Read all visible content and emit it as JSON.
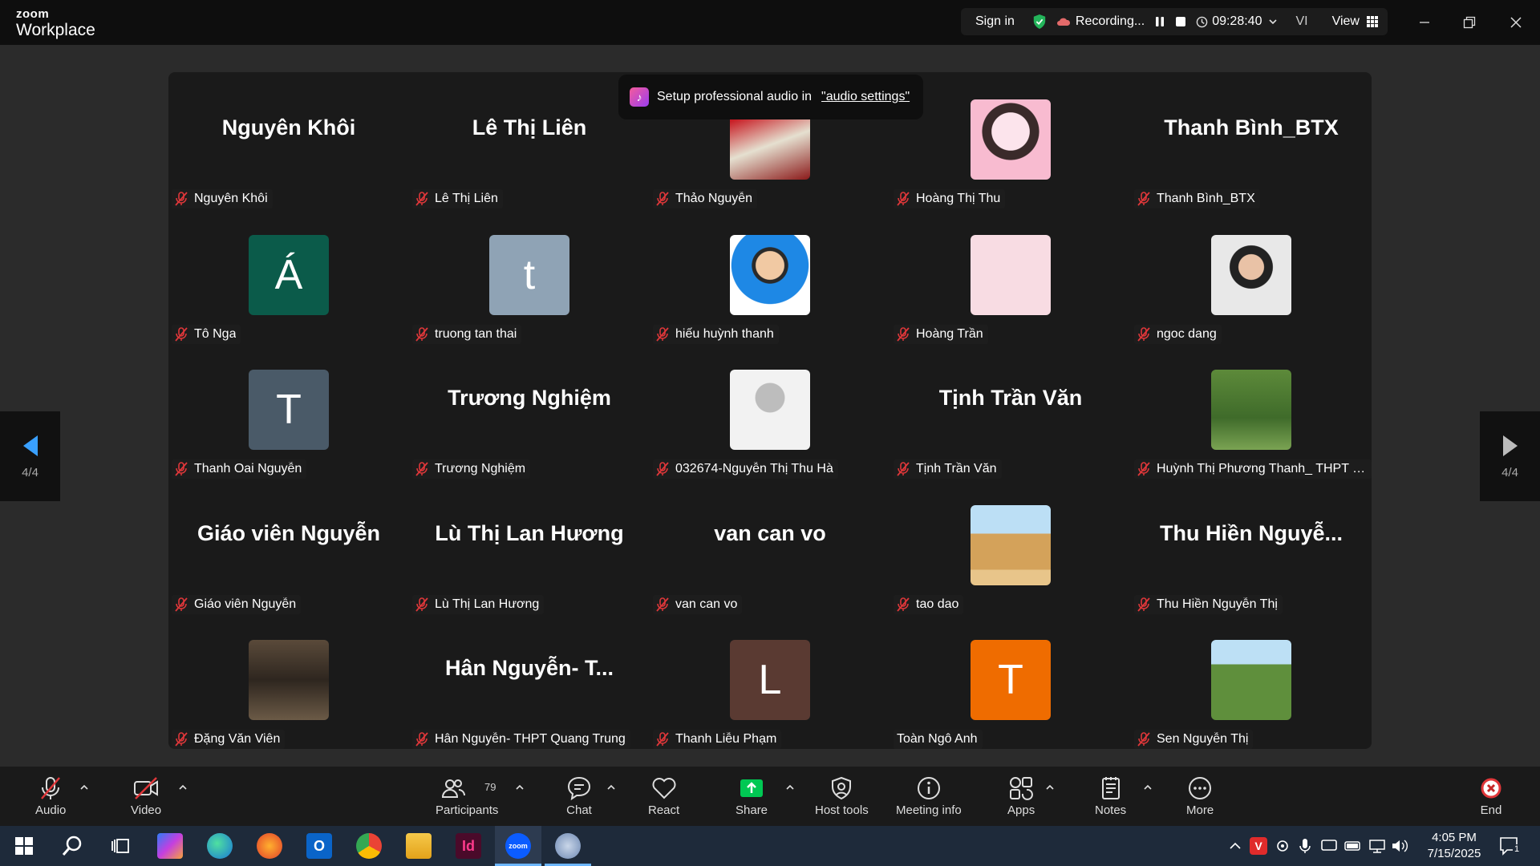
{
  "app": {
    "logo_small": "zoom",
    "logo_big": "Workplace"
  },
  "titlebar": {
    "sign_in": "Sign in",
    "recording": "Recording...",
    "timer": "09:28:40",
    "language": "VI",
    "view": "View"
  },
  "toast": {
    "message": "Setup professional audio in",
    "link": "\"audio settings\""
  },
  "pager": {
    "left": "4/4",
    "right": "4/4"
  },
  "tiles": [
    {
      "big": "Nguyên Khôi",
      "label": "Nguyên Khôi",
      "muted": true
    },
    {
      "big": "Lê Thị Liên",
      "label": "Lê Thị Liên",
      "muted": true
    },
    {
      "avatar": "photo-red",
      "label": "Thảo Nguyễn",
      "muted": true
    },
    {
      "avatar": "photo-girl",
      "label": "Hoàng Thị Thu",
      "muted": true
    },
    {
      "big": "Thanh Bình_BTX",
      "label": "Thanh Bình_BTX",
      "muted": true
    },
    {
      "letter": "Á",
      "color": "#0b5b4a",
      "label": "Tô Nga",
      "muted": true
    },
    {
      "letter": "t",
      "color": "#8fa3b5",
      "label": "truong tan thai",
      "muted": true
    },
    {
      "avatar": "photo-man",
      "label": "hiếu huỳnh thanh",
      "muted": true
    },
    {
      "avatar": "photo-glasses",
      "label": "Hoàng Trần",
      "muted": true
    },
    {
      "avatar": "photo-woman",
      "label": "ngoc dang",
      "muted": true
    },
    {
      "letter": "T",
      "color": "#4a5a68",
      "label": "Thanh Oai Nguyễn",
      "muted": true
    },
    {
      "big": "Trương Nghiệm",
      "label": "Trương Nghiệm",
      "muted": true
    },
    {
      "avatar": "photo-silhouette",
      "label": "032674-Nguyễn Thị Thu Hà",
      "muted": true
    },
    {
      "big": "Tịnh Trần Văn",
      "label": "Tịnh Trần Văn",
      "muted": true
    },
    {
      "avatar": "photo-family",
      "label": "Huỳnh Thị Phương Thanh_ THPT Qua...",
      "muted": true
    },
    {
      "big": "Giáo viên Nguyễn",
      "label": "Giáo viên Nguyễn",
      "muted": true
    },
    {
      "big": "Lù Thị Lan Hương",
      "label": "Lù Thị Lan Hương",
      "muted": true
    },
    {
      "big": "van can vo",
      "label": "van can vo",
      "muted": true
    },
    {
      "avatar": "photo-mosque",
      "label": "tao dao",
      "muted": true
    },
    {
      "big": "Thu Hiền Nguyễ...",
      "label": "Thu Hiền Nguyễn Thị",
      "muted": true
    },
    {
      "avatar": "photo-room",
      "label": "Đặng Văn Viên",
      "muted": true
    },
    {
      "big": "Hân Nguyễn- T...",
      "label": "Hân Nguyễn- THPT Quang Trung",
      "muted": true
    },
    {
      "letter": "L",
      "color": "#5a3a32",
      "label": "Thanh Liễu Phạm",
      "muted": true
    },
    {
      "letter": "T",
      "color": "#ef6c00",
      "label": "Toàn Ngô Anh",
      "muted": false
    },
    {
      "avatar": "photo-kids",
      "label": "Sen Nguyễn Thị",
      "muted": true
    }
  ],
  "toolbar": {
    "audio": "Audio",
    "video": "Video",
    "participants": "Participants",
    "participants_count": "79",
    "chat": "Chat",
    "react": "React",
    "share": "Share",
    "host_tools": "Host tools",
    "meeting_info": "Meeting info",
    "apps": "Apps",
    "notes": "Notes",
    "more": "More",
    "end": "End"
  },
  "taskbar": {
    "time": "4:05 PM",
    "date": "7/15/2025",
    "notif_count": "1"
  },
  "colors": {
    "accent_green": "#00c853",
    "mute_red": "#e0373a",
    "end_red": "#e0373a"
  }
}
